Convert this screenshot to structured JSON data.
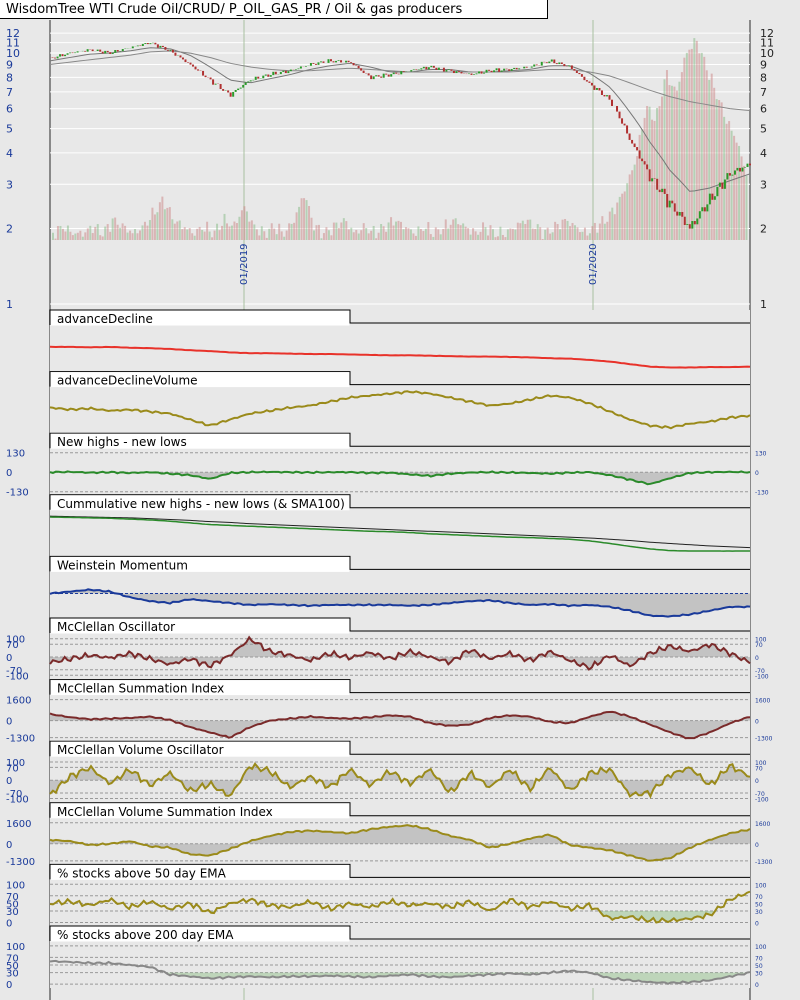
{
  "header": {
    "title": "WisdomTree WTI Crude Oil/CRUD/ P_OIL_GAS_PR / Oil & gas producers"
  },
  "colors": {
    "background": "#e8e8e8",
    "axis_label": "#1a3a9a",
    "up": "#2a9a2a",
    "down": "#b03030",
    "red": "#e8322a",
    "olive": "#9a8a1a",
    "maroon": "#7a2a2a",
    "green": "#2a8a2a",
    "blue": "#1a3a9a",
    "gray": "#888888"
  },
  "chart_data": [
    {
      "type": "line",
      "name": "price",
      "title": "WisdomTree WTI Crude Oil/CRUD/ P_OIL_GAS_PR / Oil & gas producers",
      "yscale": "log",
      "ylim": [
        1,
        13
      ],
      "yticks": [
        "12",
        "11",
        "10",
        "9",
        "8",
        "7",
        "6",
        "5",
        "4",
        "3",
        "2",
        "1"
      ],
      "ytick_values": [
        12,
        11,
        10,
        9,
        8,
        7,
        6,
        5,
        4,
        3,
        2,
        1
      ],
      "xticks": [
        "01/2019",
        "01/2020"
      ],
      "values": [
        9.5,
        10,
        10.3,
        10,
        10.5,
        11,
        10.2,
        9,
        7.8,
        6.8,
        7.8,
        8.2,
        8.5,
        9,
        9.3,
        9.2,
        8,
        8.2,
        8.5,
        8.8,
        8.5,
        8.2,
        8.5,
        8.6,
        8.8,
        9.3,
        8.8,
        7.5,
        6.5,
        4.5,
        3.2,
        2.5,
        2.0,
        2.6,
        3.3,
        3.6
      ],
      "sma_short": [
        9.3,
        9.6,
        9.9,
        10,
        10.2,
        10.5,
        10.4,
        9.8,
        8.8,
        7.8,
        7.6,
        7.9,
        8.2,
        8.6,
        8.9,
        9.1,
        8.8,
        8.4,
        8.4,
        8.6,
        8.6,
        8.4,
        8.4,
        8.5,
        8.6,
        8.9,
        8.9,
        8.3,
        7.3,
        5.8,
        4.4,
        3.4,
        2.8,
        2.9,
        3.1,
        3.3
      ],
      "sma_long": [
        9.0,
        9.2,
        9.4,
        9.6,
        9.8,
        10.1,
        10.2,
        10,
        9.6,
        9.1,
        8.8,
        8.6,
        8.5,
        8.5,
        8.6,
        8.7,
        8.6,
        8.5,
        8.4,
        8.4,
        8.4,
        8.4,
        8.4,
        8.4,
        8.5,
        8.6,
        8.6,
        8.4,
        8.1,
        7.6,
        7.1,
        6.7,
        6.4,
        6.2,
        6.0,
        5.9
      ],
      "volume": [
        1,
        2,
        1,
        1,
        2,
        1,
        3,
        2,
        1,
        2,
        4,
        6,
        3,
        2,
        1,
        2,
        1,
        3,
        2,
        5,
        2,
        1,
        2,
        1,
        3,
        7,
        2,
        1,
        2,
        3,
        1,
        2,
        1,
        2,
        3,
        2,
        1,
        2,
        1,
        2,
        3,
        2,
        1,
        2,
        1,
        1,
        2,
        3,
        2,
        1,
        2,
        3,
        2,
        1,
        2,
        3,
        5,
        8,
        12,
        20,
        18,
        25,
        22,
        28,
        30,
        26,
        22,
        18,
        15,
        10
      ]
    },
    {
      "type": "line",
      "name": "advanceDecline",
      "title": "advanceDecline",
      "ylim": [
        0,
        1
      ],
      "color": "#e8322a",
      "values": [
        0.55,
        0.55,
        0.54,
        0.55,
        0.53,
        0.52,
        0.5,
        0.47,
        0.45,
        0.42,
        0.4,
        0.4,
        0.39,
        0.38,
        0.38,
        0.37,
        0.36,
        0.35,
        0.35,
        0.34,
        0.33,
        0.32,
        0.32,
        0.31,
        0.3,
        0.28,
        0.27,
        0.24,
        0.2,
        0.14,
        0.08,
        0.06,
        0.06,
        0.07,
        0.07,
        0.08
      ]
    },
    {
      "type": "line",
      "name": "advanceDeclineVolume",
      "title": "advanceDeclineVolume",
      "ylim": [
        0,
        1.05
      ],
      "color": "#9a8a1a",
      "values": [
        0.6,
        0.55,
        0.58,
        0.52,
        0.55,
        0.5,
        0.45,
        0.3,
        0.15,
        0.3,
        0.45,
        0.52,
        0.6,
        0.65,
        0.75,
        0.85,
        0.9,
        0.95,
        1.0,
        0.95,
        0.85,
        0.75,
        0.65,
        0.7,
        0.8,
        0.9,
        0.85,
        0.7,
        0.5,
        0.3,
        0.15,
        0.1,
        0.2,
        0.25,
        0.35,
        0.4
      ]
    },
    {
      "type": "line",
      "name": "newHighsNewLows",
      "title": "New highs - new lows",
      "ylim": [
        -140,
        140
      ],
      "color": "#2a8a2a",
      "levels": [
        130,
        0,
        -130
      ],
      "level_labels": [
        "130",
        "0",
        "-130"
      ],
      "fill_zero": true,
      "values": [
        0,
        2,
        -3,
        0,
        -5,
        0,
        -10,
        -20,
        -45,
        -5,
        0,
        2,
        0,
        -2,
        0,
        0,
        -5,
        -3,
        -15,
        -25,
        -10,
        -2,
        0,
        -2,
        -5,
        -10,
        -3,
        0,
        -20,
        -50,
        -80,
        -40,
        -5,
        0,
        2,
        0
      ]
    },
    {
      "type": "line",
      "name": "cumulativeNewHighsNewLows",
      "title": "Cummulative new highs - new lows (& SMA100)",
      "ylim": [
        0,
        1
      ],
      "color": "#2a8a2a",
      "values": [
        0.9,
        0.89,
        0.88,
        0.87,
        0.85,
        0.83,
        0.8,
        0.76,
        0.72,
        0.7,
        0.68,
        0.66,
        0.64,
        0.62,
        0.6,
        0.58,
        0.56,
        0.55,
        0.53,
        0.5,
        0.48,
        0.46,
        0.44,
        0.42,
        0.41,
        0.39,
        0.37,
        0.33,
        0.27,
        0.2,
        0.14,
        0.1,
        0.09,
        0.09,
        0.09,
        0.09
      ],
      "sma": [
        0.92,
        0.91,
        0.9,
        0.89,
        0.88,
        0.86,
        0.84,
        0.82,
        0.79,
        0.77,
        0.74,
        0.72,
        0.7,
        0.68,
        0.66,
        0.64,
        0.62,
        0.6,
        0.58,
        0.56,
        0.54,
        0.52,
        0.5,
        0.48,
        0.46,
        0.44,
        0.42,
        0.4,
        0.37,
        0.34,
        0.3,
        0.27,
        0.24,
        0.21,
        0.19,
        0.17
      ]
    },
    {
      "type": "line",
      "name": "weinsteinMomentum",
      "title": "Weinstein Momentum",
      "ylim": [
        -0.6,
        0.5
      ],
      "color": "#1a3a9a",
      "fill_zero": true,
      "values": [
        0.0,
        0.05,
        0.1,
        0.05,
        -0.1,
        -0.2,
        -0.25,
        -0.15,
        -0.2,
        -0.25,
        -0.3,
        -0.28,
        -0.3,
        -0.32,
        -0.3,
        -0.3,
        -0.3,
        -0.3,
        -0.32,
        -0.3,
        -0.25,
        -0.2,
        -0.18,
        -0.25,
        -0.3,
        -0.28,
        -0.32,
        -0.3,
        -0.35,
        -0.45,
        -0.58,
        -0.6,
        -0.55,
        -0.45,
        -0.35,
        -0.35
      ]
    },
    {
      "type": "line",
      "name": "mcclellanOscillator",
      "title": "McClellan Oscillator",
      "ylim": [
        -115,
        115
      ],
      "color": "#7a2a2a",
      "levels": [
        100,
        70,
        0,
        -70,
        -100
      ],
      "level_labels": [
        "100",
        "70",
        "0",
        "-70",
        "-100"
      ],
      "fill_zero": true,
      "values": [
        -30,
        -10,
        10,
        -5,
        20,
        -10,
        -40,
        -10,
        -50,
        10,
        100,
        30,
        10,
        -20,
        20,
        -5,
        25,
        -10,
        30,
        0,
        -30,
        40,
        -10,
        20,
        -20,
        30,
        -20,
        -60,
        10,
        -50,
        20,
        60,
        30,
        70,
        20,
        -30
      ]
    },
    {
      "type": "line",
      "name": "mcclellanSummationIndex",
      "title": "McClellan Summation Index",
      "ylim": [
        -1450,
        1750
      ],
      "color": "#7a2a2a",
      "levels": [
        1600,
        0,
        -1300
      ],
      "level_labels": [
        "1600",
        "0",
        "-1300"
      ],
      "fill_zero": true,
      "values": [
        500,
        250,
        100,
        150,
        200,
        300,
        50,
        -500,
        -900,
        -1300,
        -500,
        0,
        150,
        300,
        200,
        150,
        250,
        400,
        300,
        -200,
        -400,
        -300,
        200,
        400,
        300,
        -100,
        -200,
        300,
        700,
        300,
        -300,
        -900,
        -1400,
        -900,
        -200,
        300
      ]
    },
    {
      "type": "line",
      "name": "mcclellanVolumeOscillator",
      "title": "McClellan Volume Oscillator",
      "ylim": [
        -115,
        115
      ],
      "color": "#9a8a1a",
      "levels": [
        100,
        70,
        0,
        -70,
        -100
      ],
      "level_labels": [
        "100",
        "70",
        "0",
        "-70",
        "-100"
      ],
      "fill_zero": true,
      "values": [
        -80,
        20,
        70,
        -20,
        60,
        -30,
        40,
        -60,
        -20,
        -90,
        80,
        50,
        -40,
        20,
        -40,
        60,
        -30,
        50,
        -20,
        60,
        -70,
        40,
        -40,
        60,
        -50,
        70,
        -60,
        40,
        60,
        -80,
        -70,
        30,
        70,
        -30,
        80,
        20
      ]
    },
    {
      "type": "line",
      "name": "mcclellanVolumeSummationIndex",
      "title": "McClellan Volume Summation Index",
      "ylim": [
        -1450,
        1750
      ],
      "color": "#9a8a1a",
      "levels": [
        1600,
        0,
        -1300
      ],
      "level_labels": [
        "1600",
        "0",
        "-1300"
      ],
      "fill_zero": true,
      "values": [
        300,
        200,
        -100,
        0,
        200,
        -200,
        -300,
        -800,
        -900,
        -400,
        200,
        600,
        900,
        1000,
        900,
        800,
        1100,
        1300,
        1400,
        1100,
        600,
        300,
        -300,
        0,
        400,
        700,
        -100,
        -300,
        -500,
        -900,
        -1300,
        -1100,
        -300,
        300,
        800,
        1100
      ]
    },
    {
      "type": "line",
      "name": "pctAbove50EMA",
      "title": "% stocks above 50 day EMA",
      "ylim": [
        -5,
        105
      ],
      "color": "#9a8a1a",
      "levels": [
        100,
        70,
        50,
        30,
        0
      ],
      "level_labels": [
        "100",
        "70",
        "50",
        "30",
        "0"
      ],
      "fill_below": 30,
      "values": [
        50,
        55,
        45,
        60,
        40,
        55,
        35,
        50,
        25,
        50,
        60,
        45,
        40,
        55,
        35,
        50,
        40,
        55,
        45,
        50,
        40,
        55,
        30,
        60,
        40,
        55,
        35,
        45,
        10,
        15,
        5,
        5,
        10,
        20,
        60,
        80
      ]
    },
    {
      "type": "line",
      "name": "pctAbove200EMA",
      "title": "% stocks above 200 day EMA",
      "ylim": [
        -5,
        105
      ],
      "color": "#888888",
      "levels": [
        100,
        70,
        50,
        30,
        0
      ],
      "level_labels": [
        "100",
        "70",
        "50",
        "30",
        "0"
      ],
      "fill_below": 30,
      "values": [
        60,
        58,
        55,
        55,
        50,
        45,
        25,
        20,
        15,
        18,
        20,
        18,
        20,
        20,
        22,
        20,
        18,
        22,
        25,
        20,
        18,
        22,
        25,
        28,
        25,
        30,
        35,
        30,
        15,
        10,
        5,
        3,
        5,
        10,
        20,
        30
      ]
    }
  ]
}
